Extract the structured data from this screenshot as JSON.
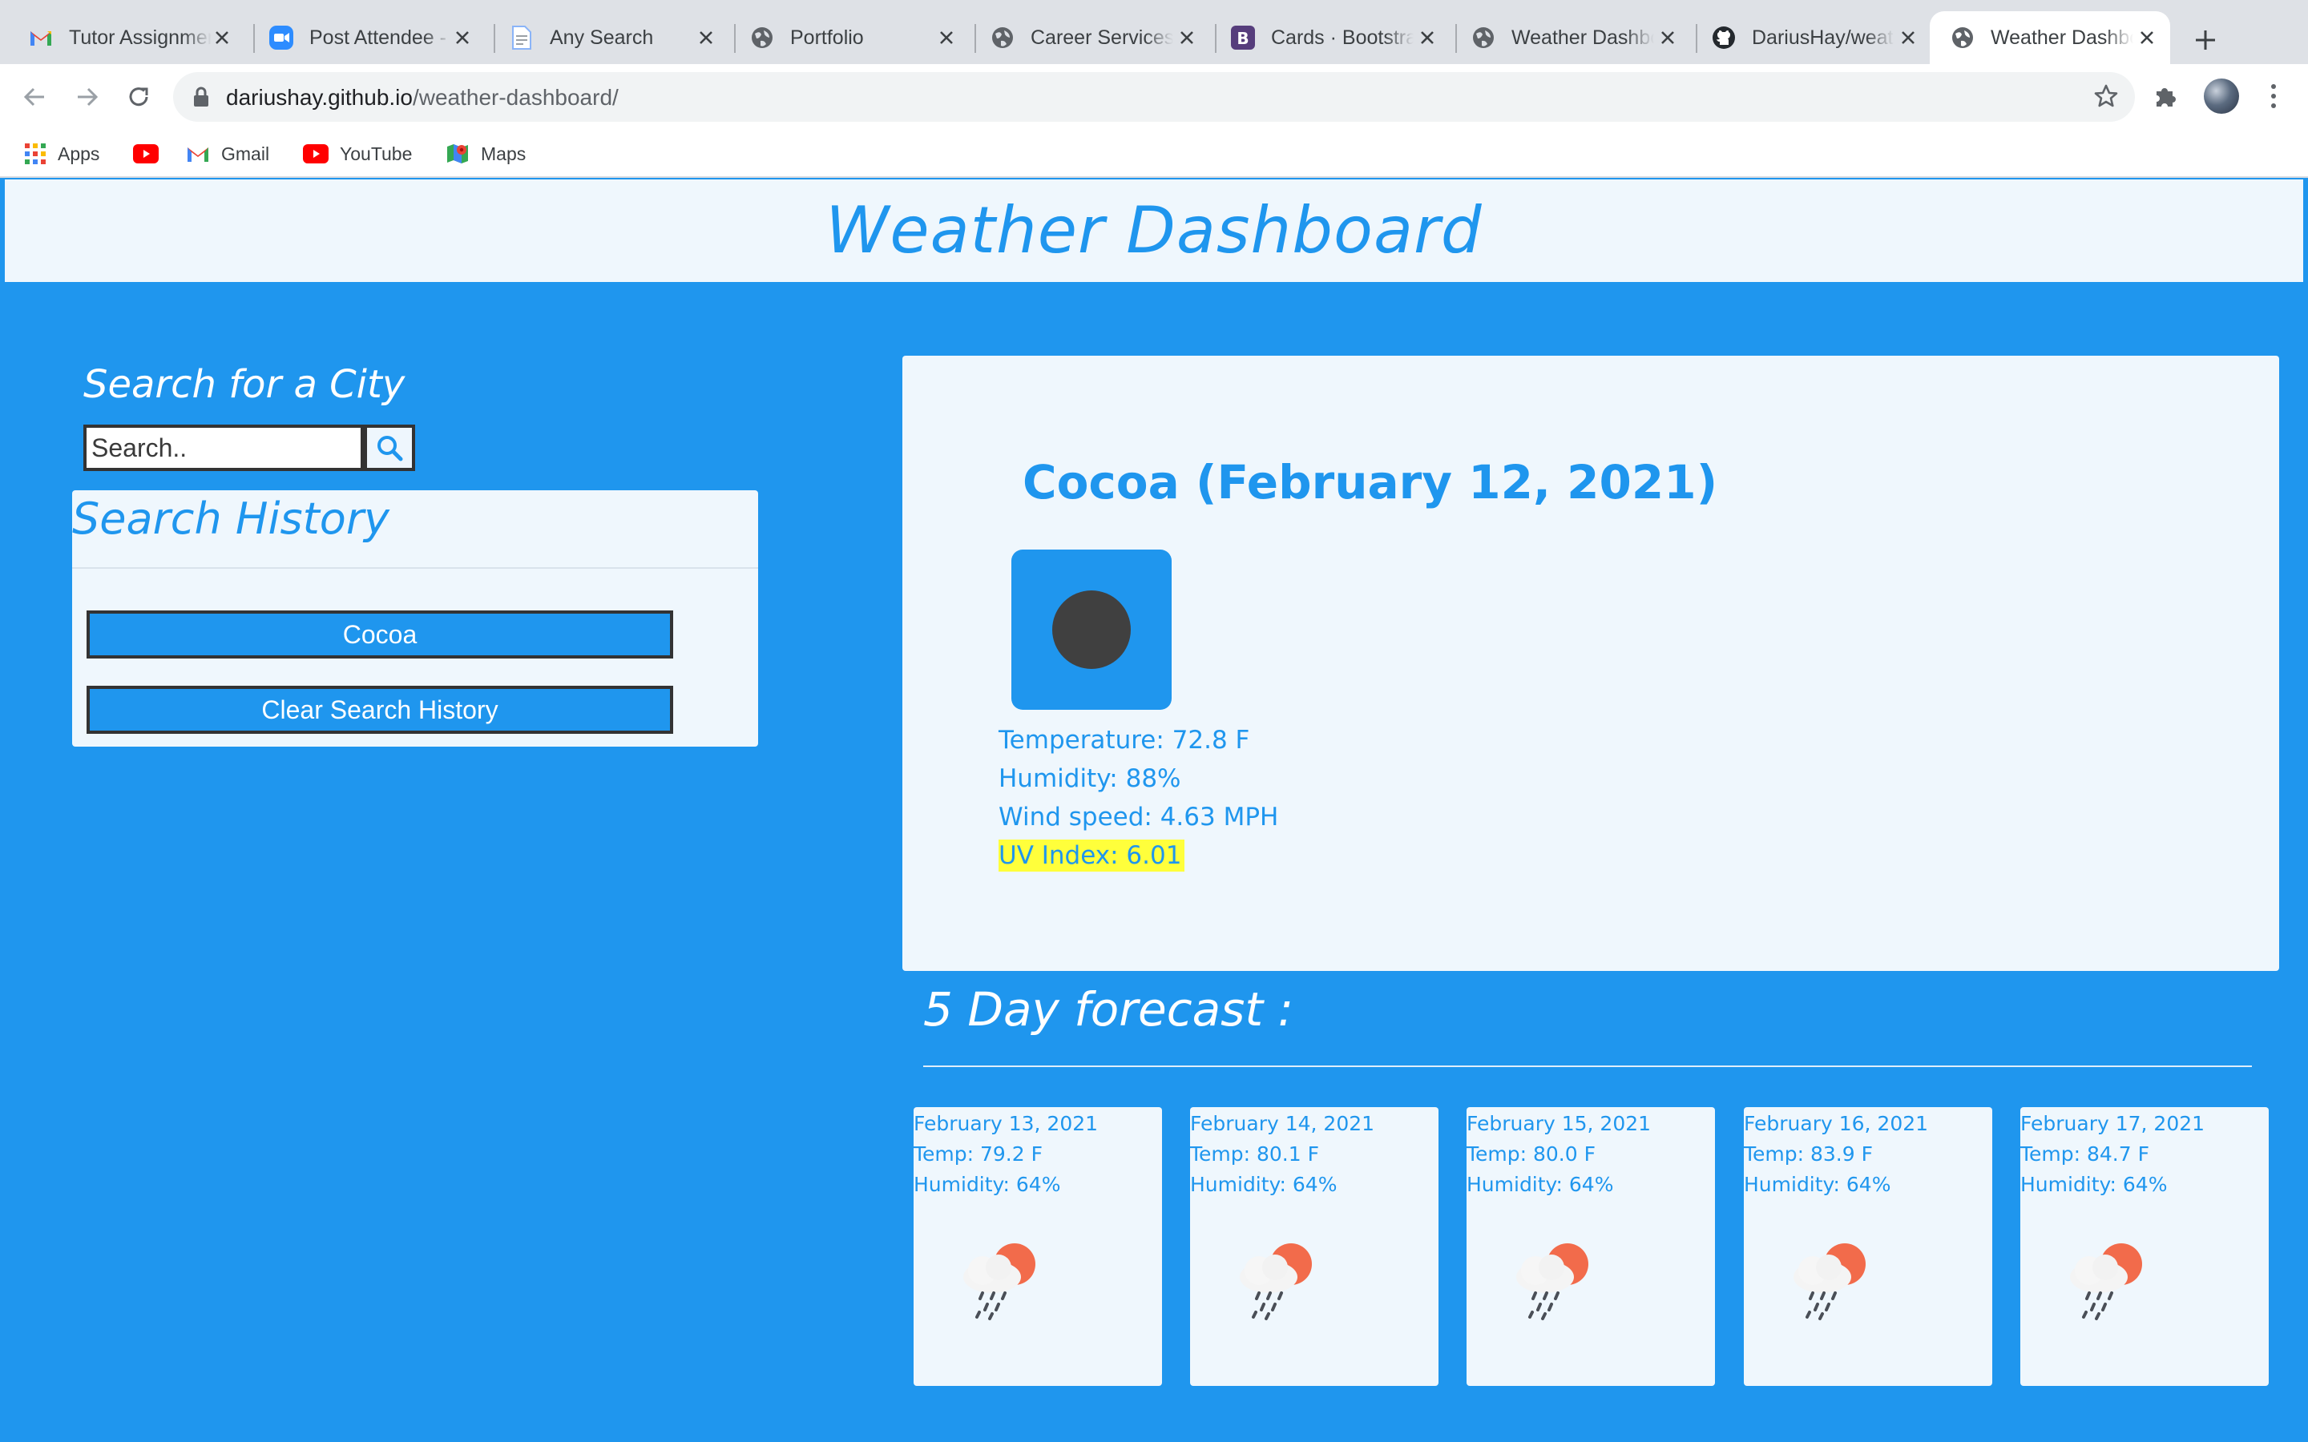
{
  "browser": {
    "tabs": [
      {
        "title": "Tutor Assignments",
        "icon": "gmail-icon"
      },
      {
        "title": "Post Attendee - Zoom",
        "icon": "zoom-icon"
      },
      {
        "title": "Any Search",
        "icon": "document-icon"
      },
      {
        "title": "Portfolio",
        "icon": "globe-icon"
      },
      {
        "title": "Career Services",
        "icon": "globe-icon"
      },
      {
        "title": "Cards · Bootstrap",
        "icon": "bootstrap-icon"
      },
      {
        "title": "Weather Dashboard",
        "icon": "globe-icon"
      },
      {
        "title": "DariusHay/weather-dashboard",
        "icon": "github-icon"
      },
      {
        "title": "Weather Dashboard",
        "icon": "globe-icon",
        "active": true
      }
    ],
    "url_host": "dariushay.github.io",
    "url_path": "/weather-dashboard/",
    "bookmarks": [
      {
        "label": "Apps",
        "icon": "apps-grid-icon"
      },
      {
        "label": "",
        "icon": "youtube-icon"
      },
      {
        "label": "Gmail",
        "icon": "gmail-icon"
      },
      {
        "label": "YouTube",
        "icon": "youtube-icon"
      },
      {
        "label": "Maps",
        "icon": "maps-icon"
      }
    ]
  },
  "page": {
    "title": "Weather Dashboard",
    "search": {
      "heading": "Search for a City",
      "placeholder": "Search.."
    },
    "history": {
      "heading": "Search History",
      "items": [
        "Cocoa"
      ],
      "clear_label": "Clear Search History"
    },
    "current": {
      "city_date": "Cocoa (February 12, 2021)",
      "temperature": "Temperature: 72.8 F",
      "humidity": "Humidity: 88%",
      "wind": "Wind speed: 4.63 MPH",
      "uv": "UV Index: 6.01"
    },
    "forecast": {
      "heading": "5 Day forecast :",
      "days": [
        {
          "date": "February 13, 2021",
          "temp": "Temp: 79.2 F",
          "humidity": "Humidity: 64%",
          "icon": "rain-cloud-sun-icon"
        },
        {
          "date": "February 14, 2021",
          "temp": "Temp: 80.1 F",
          "humidity": "Humidity: 64%",
          "icon": "rain-cloud-sun-icon"
        },
        {
          "date": "February 15, 2021",
          "temp": "Temp: 80.0 F",
          "humidity": "Humidity: 64%",
          "icon": "rain-cloud-sun-icon"
        },
        {
          "date": "February 16, 2021",
          "temp": "Temp: 83.9 F",
          "humidity": "Humidity: 64%",
          "icon": "rain-cloud-sun-icon"
        },
        {
          "date": "February 17, 2021",
          "temp": "Temp: 84.7 F",
          "humidity": "Humidity: 64%",
          "icon": "rain-cloud-sun-icon"
        }
      ]
    }
  },
  "colors": {
    "brand_blue": "#1f96ee",
    "panel_bg": "#eff7fd",
    "uv_highlight": "#ffff3b",
    "icon_dot": "#404040"
  }
}
